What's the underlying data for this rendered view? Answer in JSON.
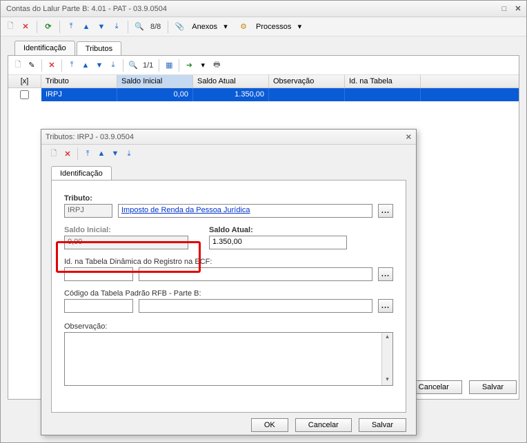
{
  "window": {
    "title": "Contas do Lalur Parte B: 4.01 - PAT - 03.9.0504"
  },
  "toolbar": {
    "count": "8/8",
    "anexos_label": "Anexos",
    "processos_label": "Processos"
  },
  "tabs": {
    "identificacao": "Identificação",
    "tributos": "Tributos"
  },
  "inner_toolbar": {
    "count": "1/1"
  },
  "grid": {
    "headers": {
      "sel": "[x]",
      "tributo": "Tributo",
      "saldo_inicial": "Saldo Inicial",
      "saldo_atual": "Saldo Atual",
      "observacao": "Observação",
      "id_tabela": "Id. na Tabela"
    },
    "row": {
      "tributo": "IRPJ",
      "saldo_inicial": "0,00",
      "saldo_atual": "1.350,00",
      "observacao": "",
      "id_tabela": ""
    }
  },
  "main_buttons": {
    "cancelar": "Cancelar",
    "salvar": "Salvar"
  },
  "dialog": {
    "title": "Tributos: IRPJ - 03.9.0504",
    "tab": "Identificação",
    "tributo_label": "Tributo:",
    "tributo_code": "IRPJ",
    "tributo_desc": "Imposto de Renda da Pessoa Jurídica",
    "saldo_inicial_label": "Saldo Inicial:",
    "saldo_inicial_value": "0,00",
    "saldo_atual_label": "Saldo Atual:",
    "saldo_atual_value": "1.350,00",
    "id_label": "Id. na Tabela Dinâmica do Registro na ECF:",
    "id_code": "",
    "id_desc": "",
    "codigo_label": "Código da Tabela Padrão RFB - Parte B:",
    "codigo_code": "",
    "codigo_desc": "",
    "obs_label": "Observação:",
    "obs_value": "",
    "ok": "OK",
    "cancelar": "Cancelar",
    "salvar": "Salvar",
    "dots": "..."
  }
}
